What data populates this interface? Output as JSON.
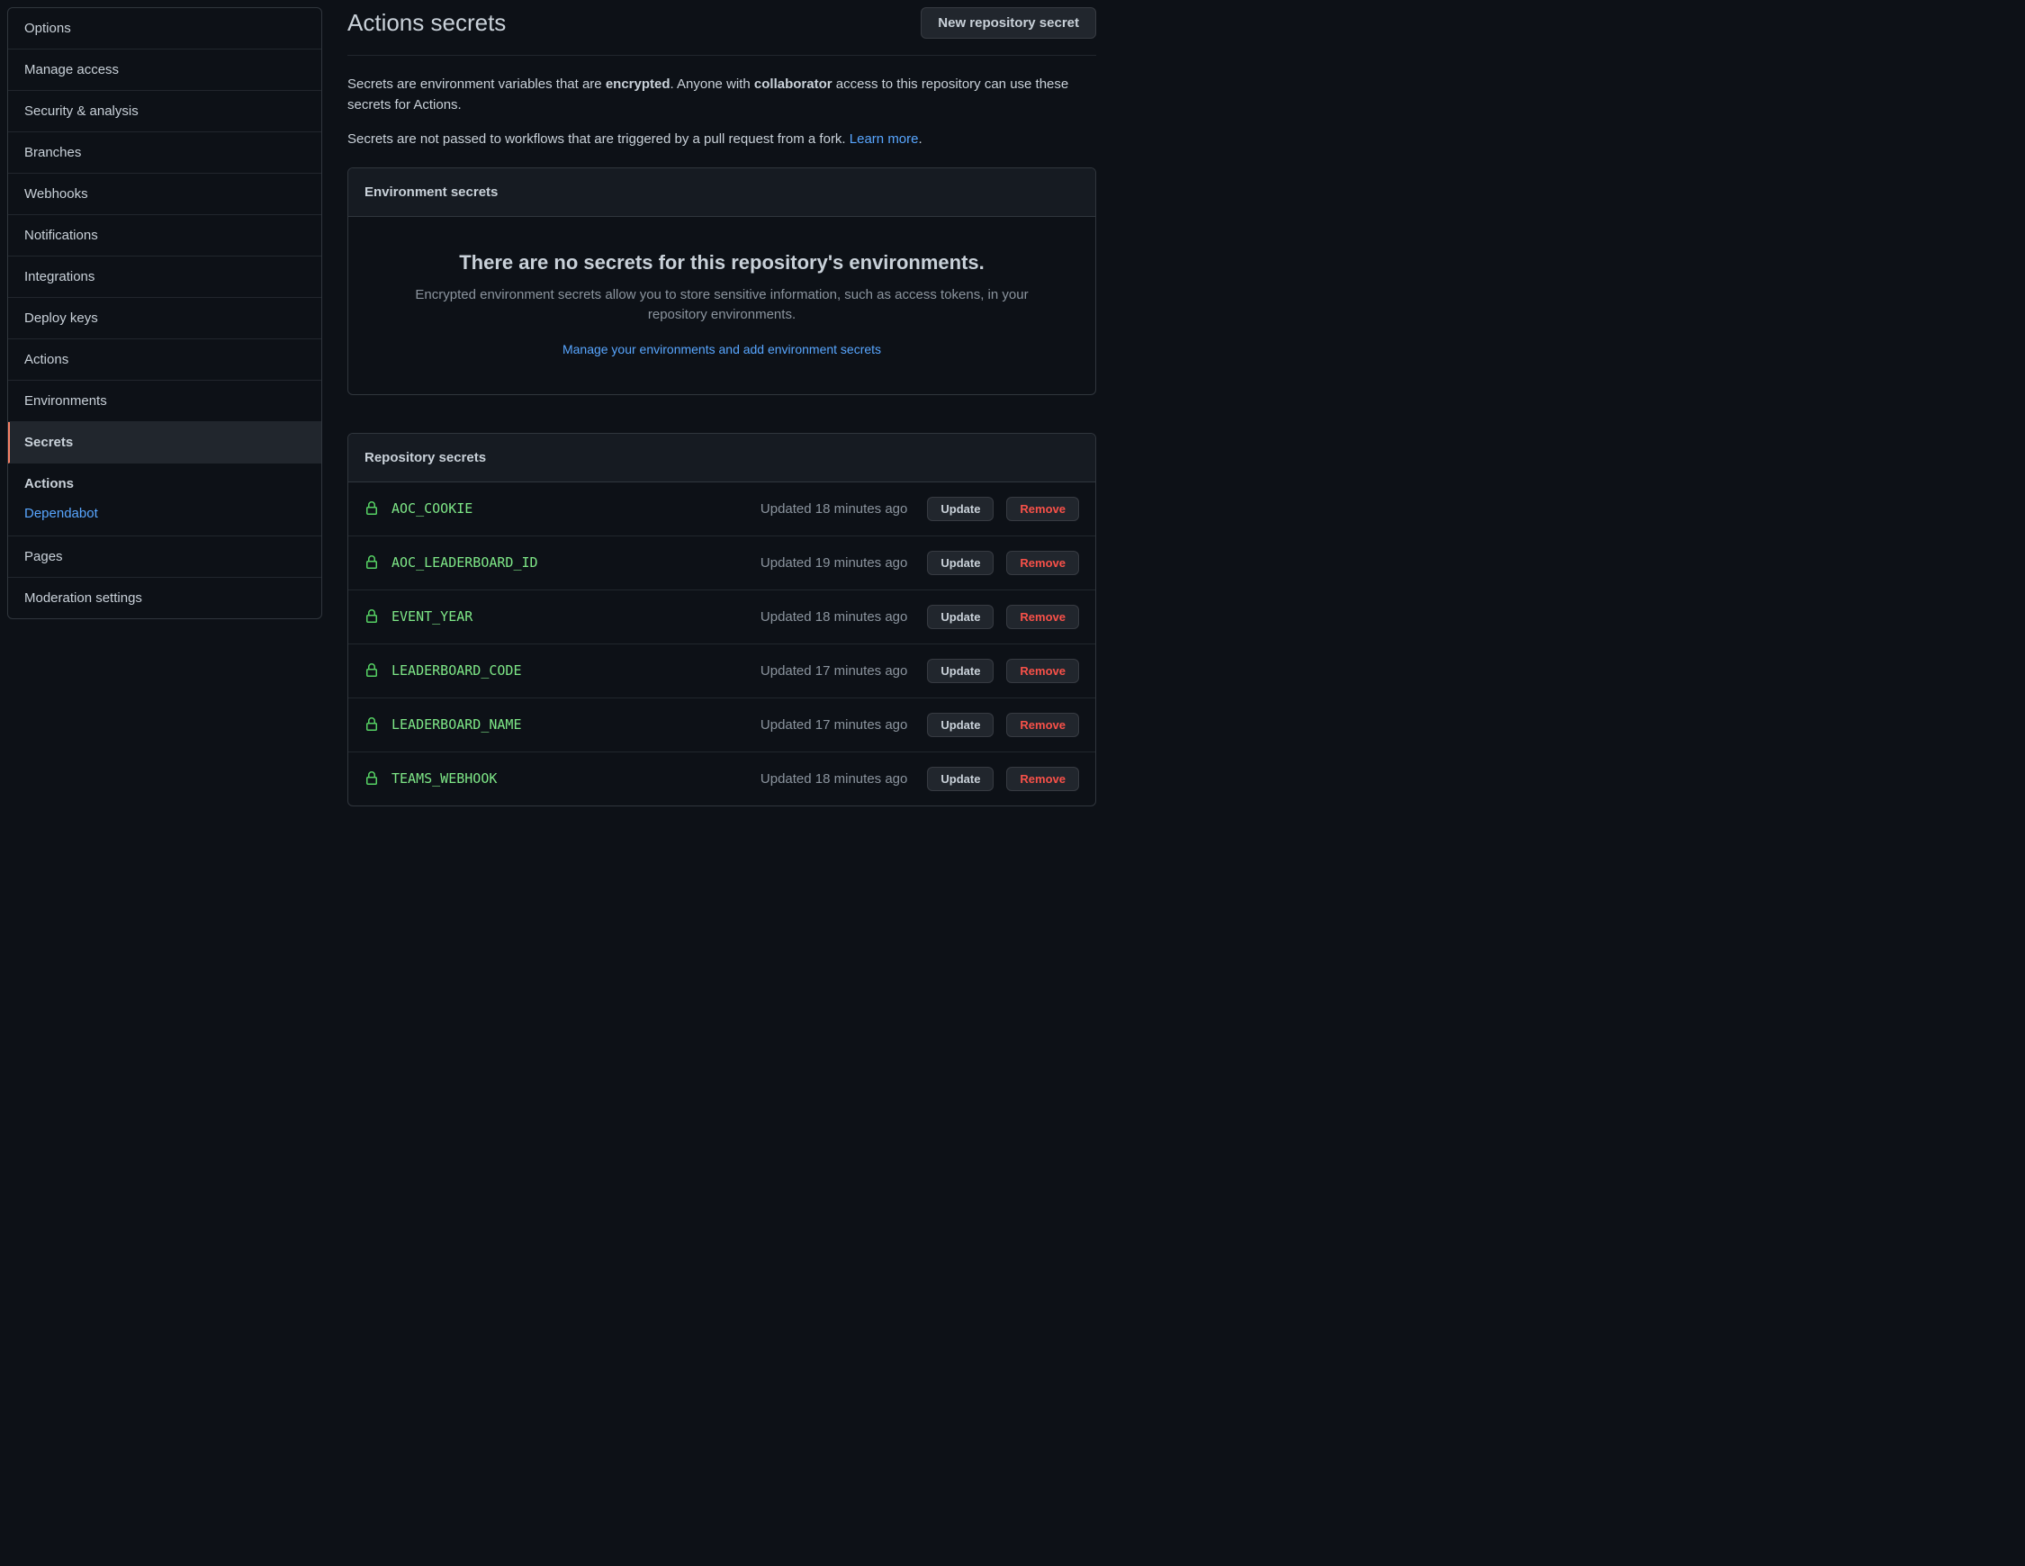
{
  "sidebar": {
    "items": [
      {
        "label": "Options"
      },
      {
        "label": "Manage access"
      },
      {
        "label": "Security & analysis"
      },
      {
        "label": "Branches"
      },
      {
        "label": "Webhooks"
      },
      {
        "label": "Notifications"
      },
      {
        "label": "Integrations"
      },
      {
        "label": "Deploy keys"
      },
      {
        "label": "Actions"
      },
      {
        "label": "Environments"
      },
      {
        "label": "Secrets"
      }
    ],
    "subgroup_header": "Actions",
    "subgroup_link": "Dependabot",
    "trailing": [
      {
        "label": "Pages"
      },
      {
        "label": "Moderation settings"
      }
    ]
  },
  "header": {
    "title": "Actions secrets",
    "new_button": "New repository secret"
  },
  "description": {
    "p1_a": "Secrets are environment variables that are ",
    "p1_b": "encrypted",
    "p1_c": ". Anyone with ",
    "p1_d": "collaborator",
    "p1_e": " access to this repository can use these secrets for Actions.",
    "p2_a": "Secrets are not passed to workflows that are triggered by a pull request from a fork. ",
    "p2_link": "Learn more",
    "p2_b": "."
  },
  "env_panel": {
    "header": "Environment secrets",
    "empty_title": "There are no secrets for this repository's environments.",
    "empty_desc": "Encrypted environment secrets allow you to store sensitive information, such as access tokens, in your repository environments.",
    "empty_link": "Manage your environments and add environment secrets"
  },
  "repo_panel": {
    "header": "Repository secrets",
    "update_label": "Update",
    "remove_label": "Remove",
    "secrets": [
      {
        "name": "AOC_COOKIE",
        "updated": "Updated 18 minutes ago"
      },
      {
        "name": "AOC_LEADERBOARD_ID",
        "updated": "Updated 19 minutes ago"
      },
      {
        "name": "EVENT_YEAR",
        "updated": "Updated 18 minutes ago"
      },
      {
        "name": "LEADERBOARD_CODE",
        "updated": "Updated 17 minutes ago"
      },
      {
        "name": "LEADERBOARD_NAME",
        "updated": "Updated 17 minutes ago"
      },
      {
        "name": "TEAMS_WEBHOOK",
        "updated": "Updated 18 minutes ago"
      }
    ]
  }
}
